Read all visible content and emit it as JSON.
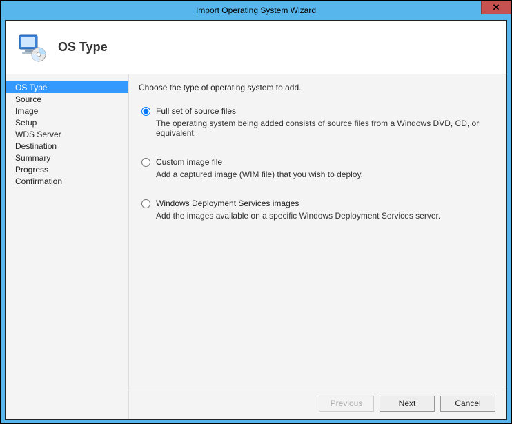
{
  "titlebar": {
    "title": "Import Operating System Wizard",
    "close": "✕"
  },
  "header": {
    "heading": "OS Type"
  },
  "sidebar": {
    "items": [
      {
        "label": "OS Type",
        "selected": true
      },
      {
        "label": "Source",
        "selected": false
      },
      {
        "label": "Image",
        "selected": false
      },
      {
        "label": "Setup",
        "selected": false
      },
      {
        "label": "WDS Server",
        "selected": false
      },
      {
        "label": "Destination",
        "selected": false
      },
      {
        "label": "Summary",
        "selected": false
      },
      {
        "label": "Progress",
        "selected": false
      },
      {
        "label": "Confirmation",
        "selected": false
      }
    ]
  },
  "main": {
    "instruction": "Choose the type of operating system to add.",
    "options": [
      {
        "label": "Full set of source files",
        "desc": "The operating system being added consists of source files from a Windows DVD, CD, or equivalent.",
        "checked": true
      },
      {
        "label": "Custom image file",
        "desc": "Add a captured image (WIM file) that you wish to deploy.",
        "checked": false
      },
      {
        "label": "Windows Deployment Services images",
        "desc": "Add the images available on a specific Windows Deployment Services server.",
        "checked": false
      }
    ]
  },
  "footer": {
    "previous": "Previous",
    "next": "Next",
    "cancel": "Cancel"
  }
}
